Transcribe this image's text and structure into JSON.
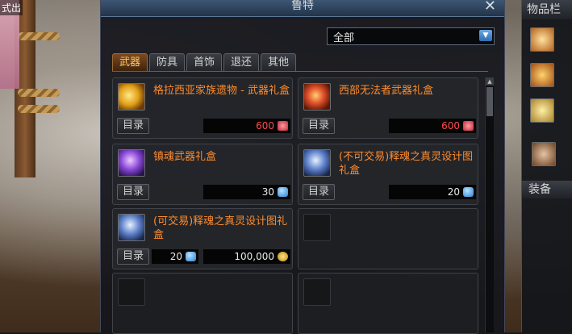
{
  "left_name": "式出",
  "shop": {
    "title": "鲁特",
    "close_glyph": "✕",
    "filter": {
      "selected": "全部"
    },
    "tabs": [
      {
        "label": "武器",
        "active": true
      },
      {
        "label": "防具",
        "active": false
      },
      {
        "label": "首饰",
        "active": false
      },
      {
        "label": "退还",
        "active": false
      },
      {
        "label": "其他",
        "active": false
      }
    ],
    "items": [
      {
        "name": "格拉西亚家族遗物 - 武器礼盒",
        "catalog": "目录",
        "price": "600",
        "currency": "cera",
        "icon": "gold-gift-icon"
      },
      {
        "name": "西部无法者武器礼盒",
        "catalog": "目录",
        "price": "600",
        "currency": "cera",
        "icon": "red-gift-icon"
      },
      {
        "name": "镇魂武器礼盒",
        "catalog": "目录",
        "price": "30",
        "currency": "gem",
        "icon": "purple-gift-icon"
      },
      {
        "name": "(不可交易)释魂之真灵设计图礼盒",
        "catalog": "目录",
        "price": "20",
        "currency": "gem",
        "icon": "blue-box-icon"
      },
      {
        "name": "(可交易)释魂之真灵设计图礼盒",
        "catalog": "目录",
        "price": "20",
        "price2": "100,000",
        "currency": "gem",
        "currency2": "gold",
        "icon": "blue-box-icon"
      }
    ]
  },
  "inventory": {
    "title": "物品栏",
    "equip_label": "装备"
  },
  "colors": {
    "item_name": "#ff8b2c",
    "cera_price": "#ff4a4a",
    "tab_active": "#ffcc60"
  }
}
